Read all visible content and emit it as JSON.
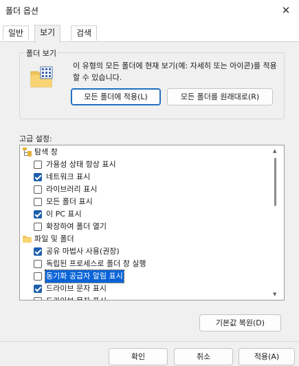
{
  "window": {
    "title": "폴더 옵션",
    "close_glyph": "✕"
  },
  "tabs": [
    {
      "label": "일반",
      "active": false
    },
    {
      "label": "보기",
      "active": true
    },
    {
      "label": "검색",
      "active": false
    }
  ],
  "folder_views": {
    "group_label": "폴더 보기",
    "description": "이 유형의 모든 폴더에 현재 보기(예: 자세히 또는 아이콘)를 적용할 수 있습니다.",
    "apply_button": "모든 폴더에 적용(L)",
    "reset_button": "모든 폴더를 원래대로(R)"
  },
  "advanced": {
    "label": "고급 설정:",
    "items": [
      {
        "type": "category",
        "icon": "navigation-pane-icon",
        "label": "탐색 창"
      },
      {
        "type": "checkbox",
        "checked": false,
        "label": "가용성 상태 항상 표시"
      },
      {
        "type": "checkbox",
        "checked": true,
        "label": "네트워크 표시"
      },
      {
        "type": "checkbox",
        "checked": false,
        "label": "라이브러리 표시"
      },
      {
        "type": "checkbox",
        "checked": false,
        "label": "모든 폴더 표시"
      },
      {
        "type": "checkbox",
        "checked": true,
        "label": "이 PC 표시"
      },
      {
        "type": "checkbox",
        "checked": false,
        "label": "확장하여 폴더 열기"
      },
      {
        "type": "category",
        "icon": "folder-icon",
        "label": "파일 및 폴더"
      },
      {
        "type": "checkbox",
        "checked": true,
        "label": "공유 마법사 사용(권장)"
      },
      {
        "type": "checkbox",
        "checked": false,
        "label": "독립된 프로세스로 폴더 창 실행"
      },
      {
        "type": "checkbox",
        "checked": false,
        "label": "동기화 공급자 알림 표시",
        "selected": true
      },
      {
        "type": "checkbox",
        "checked": true,
        "label": "드라이브 문자 표시"
      },
      {
        "type": "checkbox",
        "checked": false,
        "label": "드라이브 문자 표시"
      }
    ],
    "restore_defaults_button": "기본값 복원(D)"
  },
  "dialog_buttons": {
    "ok": "확인",
    "cancel": "취소",
    "apply": "적용(A)"
  },
  "colors": {
    "accent": "#0a64d8",
    "checkbox_checked": "#1f5fad",
    "window_bg": "#f0f0f0"
  }
}
